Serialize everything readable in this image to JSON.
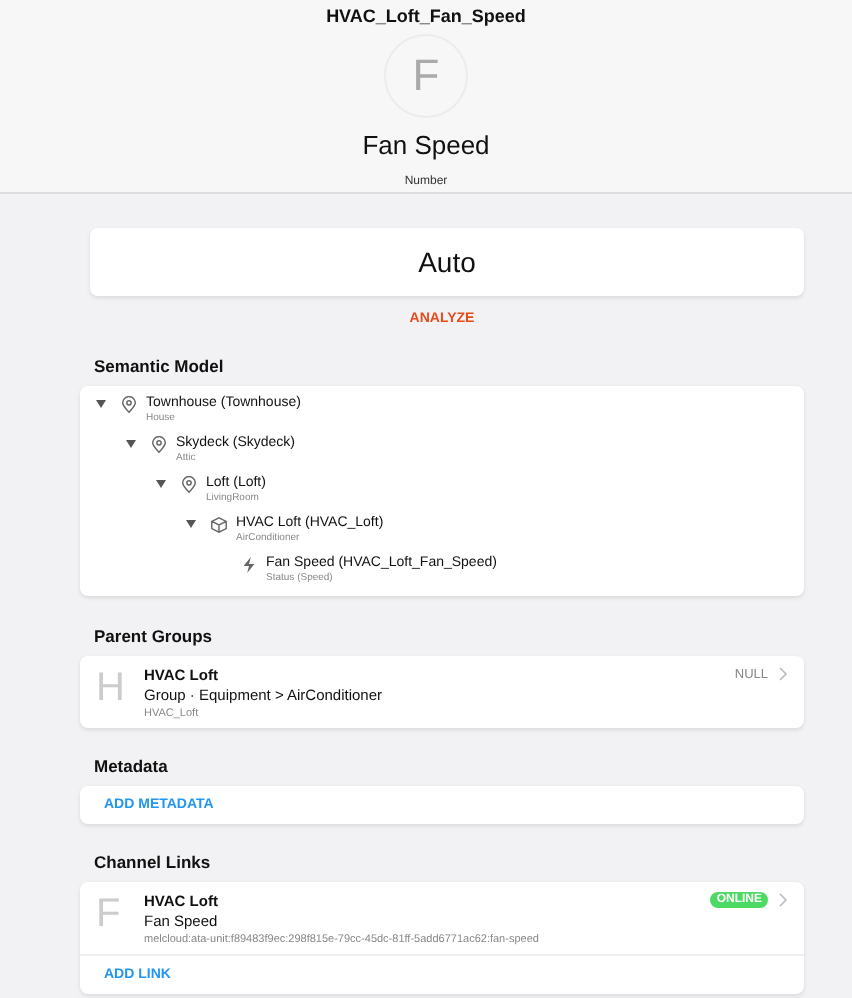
{
  "header": {
    "title": "HVAC_Loft_Fan_Speed",
    "avatar": "F",
    "label": "Fan Speed",
    "type": "Number"
  },
  "state": {
    "value": "Auto",
    "action": "ANALYZE"
  },
  "semantic_model": {
    "title": "Semantic Model",
    "tree": [
      {
        "kind": "location",
        "name": "Townhouse (Townhouse)",
        "sub": "House",
        "expanded": true,
        "children": [
          {
            "kind": "location",
            "name": "Skydeck (Skydeck)",
            "sub": "Attic",
            "expanded": true,
            "children": [
              {
                "kind": "location",
                "name": "Loft (Loft)",
                "sub": "LivingRoom",
                "expanded": true,
                "children": [
                  {
                    "kind": "equipment",
                    "name": "HVAC Loft (HVAC_Loft)",
                    "sub": "AirConditioner",
                    "expanded": true,
                    "children": [
                      {
                        "kind": "point",
                        "name": "Fan Speed (HVAC_Loft_Fan_Speed)",
                        "sub": "Status (Speed)"
                      }
                    ]
                  }
                ]
              }
            ]
          }
        ]
      }
    ]
  },
  "parent_groups": {
    "title": "Parent Groups",
    "items": [
      {
        "avatar": "H",
        "name": "HVAC Loft",
        "type": "Group · Equipment > AirConditioner",
        "id": "HVAC_Loft",
        "state": "NULL"
      }
    ]
  },
  "metadata": {
    "title": "Metadata",
    "action": "ADD METADATA"
  },
  "channel_links": {
    "title": "Channel Links",
    "items": [
      {
        "avatar": "F",
        "thing": "HVAC Loft",
        "channel": "Fan Speed",
        "uid": "melcloud:ata-unit:f89483f9ec:298f815e-79cc-45dc-81ff-5add6771ac62:fan-speed",
        "status": "ONLINE",
        "online": true
      }
    ],
    "action": "ADD LINK"
  }
}
